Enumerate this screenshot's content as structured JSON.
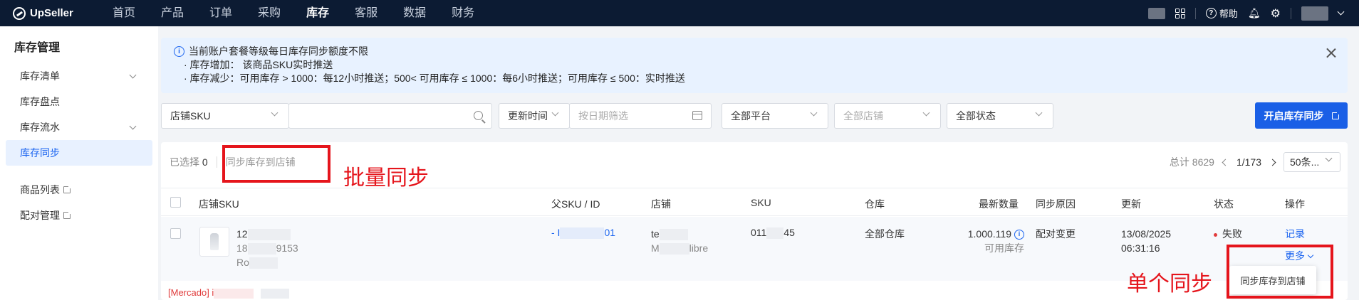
{
  "brand": {
    "name": "UpSeller"
  },
  "topnav": {
    "items": [
      {
        "label": "首页"
      },
      {
        "label": "产品"
      },
      {
        "label": "订单"
      },
      {
        "label": "采购"
      },
      {
        "label": "库存",
        "active": true
      },
      {
        "label": "客服"
      },
      {
        "label": "数据"
      },
      {
        "label": "财务"
      }
    ],
    "help_label": "帮助"
  },
  "sidebar": {
    "title": "库存管理",
    "items": [
      {
        "label": "库存清单",
        "expandable": true
      },
      {
        "label": "库存盘点"
      },
      {
        "label": "库存流水",
        "expandable": true
      },
      {
        "label": "库存同步",
        "active": true
      },
      {
        "label": "商品列表",
        "external": true
      },
      {
        "label": "配对管理",
        "external": true
      }
    ]
  },
  "notice": {
    "title": "当前账户套餐等级每日库存同步额度不限",
    "line_increase": "· 库存增加： 该商品SKU实时推送",
    "line_decrease": "· 库存减少：可用库存 > 1000：每12小时推送；500< 可用库存 ≤ 1000：每6小时推送；可用库存 ≤ 500：实时推送"
  },
  "filters": {
    "sku_type": "店铺SKU",
    "search_value": "",
    "time_type": "更新时间",
    "date_placeholder": "按日期筛选",
    "platform": "全部平台",
    "store_placeholder": "全部店铺",
    "status": "全部状态",
    "enable_sync_button": "开启库存同步"
  },
  "toolbar": {
    "selected_label": "已选择",
    "selected_count": "0",
    "batch_sync_button": "同步库存到店铺"
  },
  "pagination": {
    "total_label": "总计 8629",
    "page": "1/173",
    "page_size": "50条..."
  },
  "table": {
    "columns": [
      "店铺SKU",
      "父SKU / ID",
      "店铺",
      "SKU",
      "仓库",
      "最新数量",
      "同步原因",
      "更新",
      "状态",
      "操作"
    ],
    "rows": [
      {
        "store_sku_line1": "12",
        "store_sku_line2a": "18",
        "store_sku_line2b": "9153",
        "store_sku_line3a": "Ro",
        "store_sku_line3b": "",
        "parent_sku_a": "- I",
        "parent_sku_b": "01",
        "store_a": "te",
        "store_b": "M",
        "store_c": "libre",
        "sku_a": "011",
        "sku_b": "45",
        "warehouse": "全部仓库",
        "quantity": "1.000.119",
        "quantity_note": "可用库存",
        "sync_reason": "配对变更",
        "update_date": "13/08/2025",
        "update_time": "06:31:16",
        "status": "失败",
        "action_record": "记录",
        "action_more": "更多"
      }
    ],
    "next_row_prefix": "[Mercado] i"
  },
  "more_menu": {
    "items": [
      "同步库存到店铺"
    ]
  },
  "annotations": {
    "batch": "批量同步",
    "single": "单个同步"
  },
  "colors": {
    "nav_bg": "#0c1b33",
    "primary": "#1a5fe6",
    "annotation": "#e5151c",
    "fail": "#e23b3b"
  }
}
